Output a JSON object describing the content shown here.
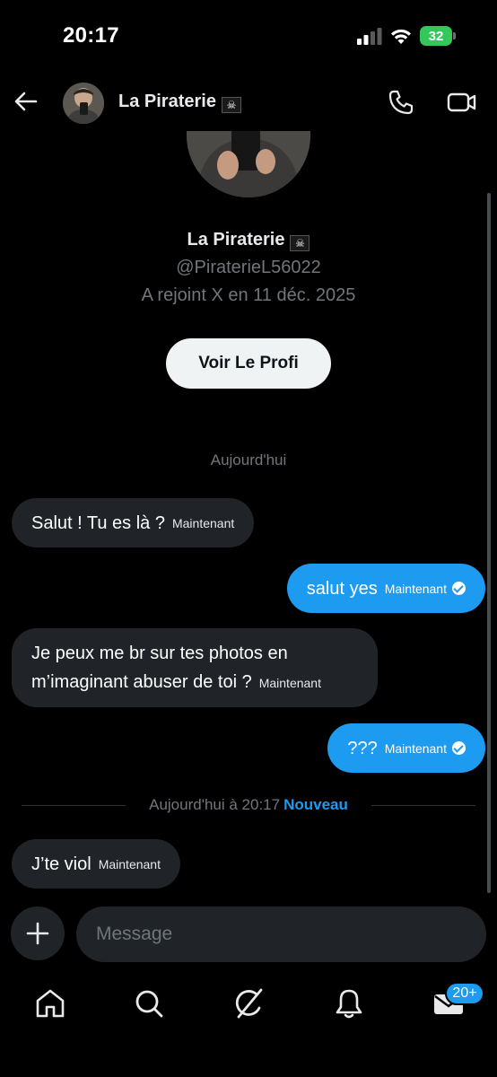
{
  "status_bar": {
    "time": "20:17",
    "battery": "32"
  },
  "header": {
    "name": "La Piraterie",
    "flag": "☠"
  },
  "profile": {
    "name": "La Piraterie",
    "flag": "☠",
    "handle": "@PiraterieL56022",
    "joined": "A rejoint X en 11 déc. 2025",
    "view_profile_label": "Voir Le Profi"
  },
  "date_label": "Aujourd'hui",
  "messages": [
    {
      "direction": "in",
      "text": "Salut ! Tu es là ?",
      "time": "Maintenant"
    },
    {
      "direction": "out",
      "text": "salut yes",
      "time": "Maintenant",
      "read": true
    },
    {
      "direction": "in",
      "text_line1": "Je peux me br sur tes photos en",
      "text_line2": "m’imaginant abuser de toi ?",
      "time": "Maintenant"
    },
    {
      "direction": "out",
      "text": "???",
      "time": "Maintenant",
      "read": true
    },
    {
      "direction": "in",
      "text": "J’te viol",
      "time": "Maintenant"
    }
  ],
  "divider": {
    "text": "Aujourd'hui à 20:17",
    "new_label": "Nouveau"
  },
  "composer": {
    "placeholder": "Message"
  },
  "bottom_nav": {
    "mail_badge": "20+"
  },
  "colors": {
    "accent": "#1d9bf0",
    "incoming_bubble": "#202327",
    "background": "#000000"
  }
}
